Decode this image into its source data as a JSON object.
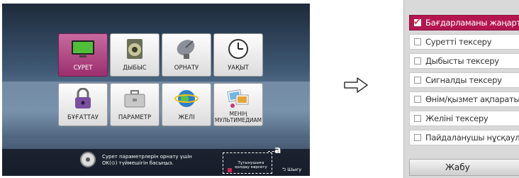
{
  "tv_menu": {
    "tiles": [
      {
        "label": "СУРЕТ",
        "icon": "tv-screen-icon",
        "selected": true
      },
      {
        "label": "ДЫБЫС",
        "icon": "speaker-icon"
      },
      {
        "label": "ОРНАТУ",
        "icon": "satellite-dish-icon"
      },
      {
        "label": "УАҚЫТ",
        "icon": "clock-icon"
      },
      {
        "label": "БҰҒАТТАУ",
        "icon": "padlock-icon"
      },
      {
        "label": "ПАРАМЕТР",
        "icon": "briefcase-icon"
      },
      {
        "label": "ЖЕЛІ",
        "icon": "globe-icon"
      },
      {
        "label": "МЕНІҢ МУЛЬТИМЕДИАМ",
        "icon": "photos-music-icon"
      }
    ],
    "hint_text": "Сурет параметрлерін орнату үшін OK(⊙) түймешігін басыңыз.",
    "help_label": "Тұтынушыға қолдау көрсету",
    "exit_label": "Шығу",
    "callout": "a",
    "accent_color": "#b3164f"
  },
  "arrow_icon": "arrow-right-outline-icon",
  "support_menu": {
    "items": [
      {
        "label": "Бағдарламаны жаңарту",
        "active": true,
        "checked": true
      },
      {
        "label": "Суретті тексеру"
      },
      {
        "label": "Дыбысты тексеру"
      },
      {
        "label": "Сигналды тексеру"
      },
      {
        "label": "Өнім/қызмет ақпараты"
      },
      {
        "label": "Желіні тексеру"
      },
      {
        "label": "Пайдаланушы нұсқаулығы"
      }
    ],
    "close_label": "Жабу"
  }
}
